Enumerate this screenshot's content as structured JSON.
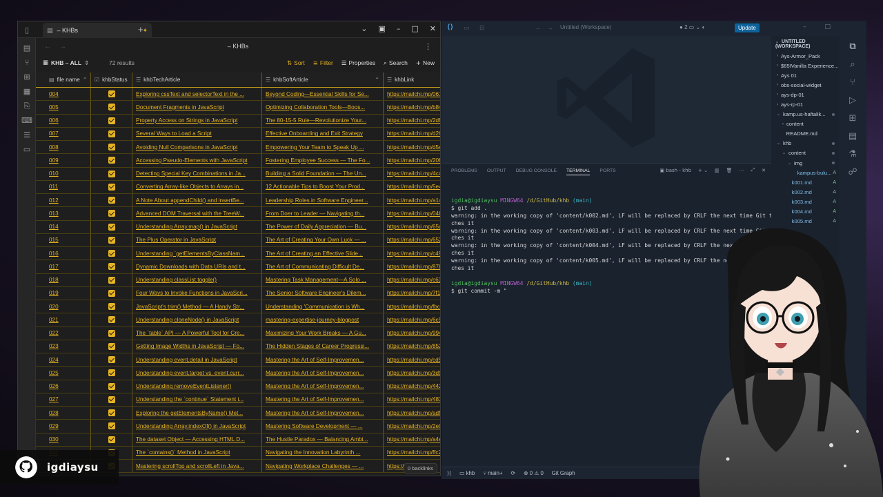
{
  "obsidian": {
    "tab_title": "– KHBs",
    "nav_title": "– KHBs",
    "view_name": "KHB – ALL",
    "result_count": "72 results",
    "toolbar": {
      "sort": "Sort",
      "filter": "Filter",
      "properties": "Properties",
      "search": "Search",
      "new": "New"
    },
    "columns": [
      "file name",
      "khbStatus",
      "khbTechArticle",
      "khbSoftArticle",
      "khbLink"
    ],
    "rows": [
      {
        "name": "004",
        "tech": "Exploring cssText and selectorText in the ...",
        "soft": "Beyond Coding—Essential Skills for Se...",
        "link": "https://mailchi.mp/061"
      },
      {
        "name": "005",
        "tech": "Document Fragments in JavaScript",
        "soft": "Optimizing Collaboration Tools—Boos...",
        "link": "https://mailchi.mp/b84"
      },
      {
        "name": "006",
        "tech": "Property Access on Strings in JavaScript",
        "soft": "The 80-15-5 Rule—Revolutionize Your...",
        "link": "https://mailchi.mp/2dfc"
      },
      {
        "name": "007",
        "tech": "Several Ways to Load a Script",
        "soft": "Effective Onboarding and Exit Strategy",
        "link": "https://mailchi.mp/d26"
      },
      {
        "name": "008",
        "tech": "Avoiding Null Comparisons in JavaScript",
        "soft": "Empowering Your Team to Speak Up ...",
        "link": "https://mailchi.mp/d5e"
      },
      {
        "name": "009",
        "tech": "Accessing Pseudo-Elements with JavaScript",
        "soft": "Fostering Employee Success — The Fo...",
        "link": "https://mailchi.mp/20f7"
      },
      {
        "name": "010",
        "tech": "Detecting Special Key Combinations in Ja...",
        "soft": "Building a Solid Foundation — The Un...",
        "link": "https://mailchi.mp/4c4"
      },
      {
        "name": "011",
        "tech": "Converting Array-like Objects to Arrays in...",
        "soft": "12 Actionable Tips to Boost Your Prod...",
        "link": "https://mailchi.mp/5e4"
      },
      {
        "name": "012",
        "tech": "A Note About appendChild() and insertBe...",
        "soft": "Leadership Roles in Software Engineer...",
        "link": "https://mailchi.mp/a14"
      },
      {
        "name": "013",
        "tech": "Advanced DOM Traversal with the TreeW...",
        "soft": "From Doer to Leader — Navigating th...",
        "link": "https://mailchi.mp/04b"
      },
      {
        "name": "014",
        "tech": "Understanding Array.map() in JavaScript",
        "soft": "The Power of Daily Appreciation — Bu...",
        "link": "https://mailchi.mp/65d"
      },
      {
        "name": "015",
        "tech": "The Plus Operator in JavaScript",
        "soft": "The Art of Creating Your Own Luck — ...",
        "link": "https://mailchi.mp/652"
      },
      {
        "name": "016",
        "tech": "Understanding `getElementsByClassNam...",
        "soft": "The Art of Creating an Effective Slide...",
        "link": "https://mailchi.mp/c49"
      },
      {
        "name": "017",
        "tech": "Dynamic Downloads with Data URIs and t...",
        "soft": "The Art of Communicating Difficult De...",
        "link": "https://mailchi.mp/87b"
      },
      {
        "name": "018",
        "tech": "Understanding classList.toggle()",
        "soft": "Mastering Task Management—A Solo ...",
        "link": "https://mailchi.mp/c63"
      },
      {
        "name": "019",
        "tech": "Four Ways to Invoke Functions in JavaScri...",
        "soft": "The Senior Software Engineer's Dilem...",
        "link": "https://mailchi.mp/7f1"
      },
      {
        "name": "020",
        "tech": "JavaScript's trim() Method — A Handy Str...",
        "soft": "Understanding 'Communication is Wh...",
        "link": "https://mailchi.mp/fbc"
      },
      {
        "name": "021",
        "tech": "Understanding cloneNode() in JavaScript",
        "soft": "mastering-expertise-journey-blogpost",
        "link": "https://mailchi.mp/6c9"
      },
      {
        "name": "022",
        "tech": "The `table` API — A Powerful Tool for Cre...",
        "soft": "Maximizing Your Work Breaks — A Gu...",
        "link": "https://mailchi.mp/994"
      },
      {
        "name": "023",
        "tech": "Getting Image Widths in JavaScript — Fo...",
        "soft": "The Hidden Stages of Career Progressi...",
        "link": "https://mailchi.mp/852"
      },
      {
        "name": "024",
        "tech": "Understanding event.detail in JavaScript",
        "soft": "Mastering the Art of Self-Improvemen...",
        "link": "https://mailchi.mp/cd5"
      },
      {
        "name": "025",
        "tech": "Understanding event.target vs. event.curr...",
        "soft": "Mastering the Art of Self-Improvemen...",
        "link": "https://mailchi.mp/3d9"
      },
      {
        "name": "026",
        "tech": "Understanding removeEventListener()",
        "soft": "Mastering the Art of Self-Improvemen...",
        "link": "https://mailchi.mp/442"
      },
      {
        "name": "027",
        "tech": "Understanding the `continue` Statement i...",
        "soft": "Mastering the Art of Self-Improvemen...",
        "link": "https://mailchi.mp/483"
      },
      {
        "name": "028",
        "tech": "Exploring the getElementsByName() Met...",
        "soft": "Mastering the Art of Self-Improvemen...",
        "link": "https://mailchi.mp/adf"
      },
      {
        "name": "029",
        "tech": "Understanding Array.indexOf() in JavaScript",
        "soft": "Mastering Software Development — ...",
        "link": "https://mailchi.mp/2e0"
      },
      {
        "name": "030",
        "tech": "The dataset Object — Accessing HTML D...",
        "soft": "The Hustle Paradox — Balancing Ambi...",
        "link": "https://mailchi.mp/a4e"
      },
      {
        "name": "031",
        "tech": "The `contains()` Method in JavaScript",
        "soft": "Navigating the Innovation Labyrinth ...",
        "link": "https://mailchi.mp/ffc2"
      },
      {
        "name": "032",
        "tech": "Mastering scrollTop and scrollLeft in Java...",
        "soft": "Navigating Workplace Challenges — ...",
        "link": "https://mailchi.mp/"
      }
    ],
    "backlinks": "0 backlinks",
    "accent_color": "#e6b422"
  },
  "vscode": {
    "window_title": "Untitled (Workspace)",
    "notif_count": "2",
    "update_label": "Update",
    "panel_tabs": [
      "PROBLEMS",
      "OUTPUT",
      "DEBUG CONSOLE",
      "TERMINAL",
      "PORTS"
    ],
    "terminal_name": "bash - khb",
    "terminal": {
      "prompt_user": "igdia@igdiaysu",
      "prompt_env": "MINGW64",
      "prompt_path": "/d/GitHub/khb",
      "prompt_branch": "(main)",
      "cmd1": "$ git add .",
      "warnings": [
        "warning: in the working copy of 'content/k002.md', LF will be replaced by CRLF the next time Git tou",
        "ches it",
        "warning: in the working copy of 'content/k003.md', LF will be replaced by CRLF the next time Git tou",
        "ches it",
        "warning: in the working copy of 'content/k004.md', LF will be replaced by CRLF the next time Git tou",
        "ches it",
        "warning: in the working copy of 'content/k005.md', LF will be replaced by CRLF the next time Git tou",
        "ches it"
      ],
      "cmd2": "$ git commit -m \""
    },
    "explorer": {
      "header": "UNTITLED (WORKSPACE)",
      "items": [
        {
          "label": "Ays-Armor_Pack",
          "depth": 0,
          "chev": "›",
          "badge": ""
        },
        {
          "label": "$65IVanilla Experience...",
          "depth": 0,
          "chev": "›",
          "badge": ""
        },
        {
          "label": "Ays 01",
          "depth": 0,
          "chev": "›",
          "badge": ""
        },
        {
          "label": "obs-social-widget",
          "depth": 0,
          "chev": "›",
          "badge": ""
        },
        {
          "label": "ays-dp-01",
          "depth": 0,
          "chev": "›",
          "badge": ""
        },
        {
          "label": "ays-rp-01",
          "depth": 0,
          "chev": "›",
          "badge": ""
        },
        {
          "label": "kamp.us-haftalik...",
          "depth": 0,
          "chev": "⌄",
          "badge": "dot"
        },
        {
          "label": "content",
          "depth": 1,
          "chev": "›",
          "badge": ""
        },
        {
          "label": "README.md",
          "depth": 1,
          "chev": "",
          "badge": ""
        },
        {
          "label": "khb",
          "depth": 0,
          "chev": "⌄",
          "badge": "dot"
        },
        {
          "label": "content",
          "depth": 1,
          "chev": "⌄",
          "badge": "dot"
        },
        {
          "label": "img",
          "depth": 2,
          "chev": "⌄",
          "badge": "dot"
        },
        {
          "label": "kampus-bulu...",
          "depth": 3,
          "chev": "",
          "badge": "A"
        },
        {
          "label": "k001.md",
          "depth": 2,
          "chev": "",
          "badge": "A"
        },
        {
          "label": "k002.md",
          "depth": 2,
          "chev": "",
          "badge": "A"
        },
        {
          "label": "k003.md",
          "depth": 2,
          "chev": "",
          "badge": "A"
        },
        {
          "label": "k004.md",
          "depth": 2,
          "chev": "",
          "badge": "A"
        },
        {
          "label": "k005.md",
          "depth": 2,
          "chev": "",
          "badge": "A"
        }
      ]
    },
    "status": {
      "folder": "khb",
      "branch": "main+",
      "errors": "0",
      "warnings": "0",
      "git_graph": "Git Graph"
    }
  },
  "overlay": {
    "github_user": "igdiaysu"
  }
}
